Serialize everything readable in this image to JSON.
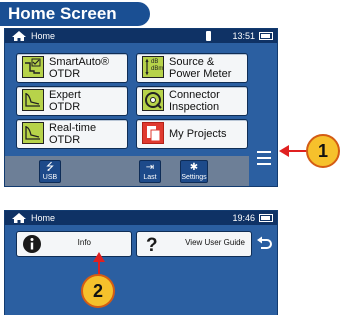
{
  "section_title": "Home Screen",
  "screen1": {
    "status": {
      "home_label": "Home",
      "time": "13:51"
    },
    "tiles": [
      {
        "label": "SmartAuto®\nOTDR",
        "icon": "smartauto-otdr-icon"
      },
      {
        "label": "Source &\nPower Meter",
        "icon": "source-power-meter-icon",
        "icon_text": "dB\ndBm"
      },
      {
        "label": "Expert\nOTDR",
        "icon": "expert-otdr-icon"
      },
      {
        "label": "Connector\nInspection",
        "icon": "connector-inspection-icon"
      },
      {
        "label": "Real-time\nOTDR",
        "icon": "realtime-otdr-icon"
      },
      {
        "label": "My Projects",
        "icon": "my-projects-icon"
      }
    ],
    "bottom_buttons": [
      {
        "label": "USB",
        "icon": "usb-icon"
      },
      {
        "label": "Last",
        "icon": "last-icon"
      },
      {
        "label": "Settings",
        "icon": "gear-icon"
      }
    ],
    "callout": "1"
  },
  "screen2": {
    "status": {
      "home_label": "Home",
      "time": "19:46"
    },
    "tiles": [
      {
        "label": "Info",
        "icon": "info-icon"
      },
      {
        "label": "View User Guide",
        "icon": "question-icon"
      }
    ],
    "callout": "2"
  },
  "colors": {
    "brand_blue": "#1a4f93",
    "screen_bg": "#2b5fa1",
    "statusbar": "#0f3265",
    "callout_fill": "#f6c12c",
    "callout_red": "#e02020",
    "otdr_green": "#b7d34a",
    "projects_red": "#e03a2f"
  }
}
